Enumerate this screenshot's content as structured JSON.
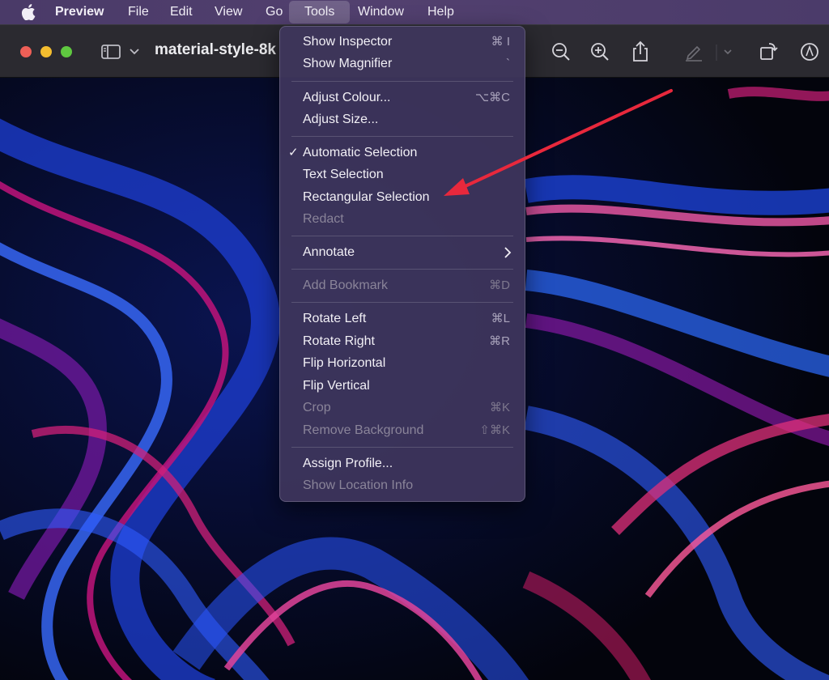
{
  "menubar": {
    "app": "Preview",
    "items": [
      "File",
      "Edit",
      "View",
      "Go",
      "Tools",
      "Window",
      "Help"
    ]
  },
  "window": {
    "title": "material-style-8k"
  },
  "tools_menu": {
    "items": [
      {
        "label": "Show Inspector",
        "shortcut": "⌘ I"
      },
      {
        "label": "Show Magnifier",
        "shortcut": "`"
      },
      {
        "label": "Adjust Colour...",
        "shortcut": "⌥⌘C"
      },
      {
        "label": "Adjust Size...",
        "shortcut": ""
      },
      {
        "label": "Automatic Selection",
        "shortcut": "",
        "checked": true
      },
      {
        "label": "Text Selection",
        "shortcut": ""
      },
      {
        "label": "Rectangular Selection",
        "shortcut": ""
      },
      {
        "label": "Redact",
        "shortcut": "",
        "disabled": true
      },
      {
        "label": "Annotate",
        "shortcut": "",
        "submenu": true
      },
      {
        "label": "Add Bookmark",
        "shortcut": "⌘D",
        "disabled": true
      },
      {
        "label": "Rotate Left",
        "shortcut": "⌘L"
      },
      {
        "label": "Rotate Right",
        "shortcut": "⌘R"
      },
      {
        "label": "Flip Horizontal",
        "shortcut": ""
      },
      {
        "label": "Flip Vertical",
        "shortcut": ""
      },
      {
        "label": "Crop",
        "shortcut": "⌘K",
        "disabled": true
      },
      {
        "label": "Remove Background",
        "shortcut": "⇧⌘K",
        "disabled": true
      },
      {
        "label": "Assign Profile...",
        "shortcut": ""
      },
      {
        "label": "Show Location Info",
        "shortcut": "",
        "disabled": true
      }
    ],
    "check_mark": "✓"
  },
  "colors": {
    "accent_arrow": "#e8283c",
    "menu_bg": "#3e365c",
    "toolbar_bg": "#2b2a30"
  },
  "icons": {
    "toolbar": [
      "sidebar-icon",
      "chevron-down-icon",
      "zoom-out-icon",
      "zoom-in-icon",
      "share-icon",
      "markup-pen-icon",
      "rotate-icon",
      "annotate-circle-icon"
    ]
  }
}
